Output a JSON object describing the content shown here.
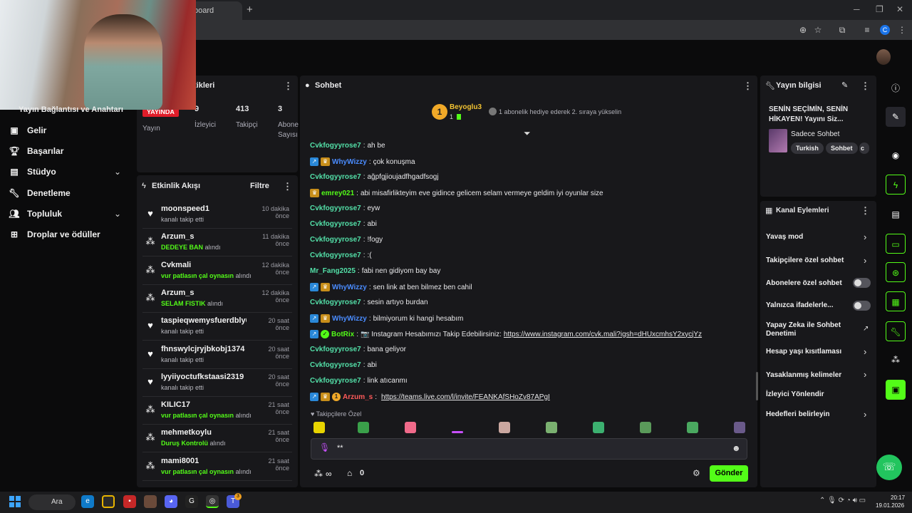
{
  "browser": {
    "tab_title": "board",
    "new_tab": "+",
    "profile_initial": "C"
  },
  "nav": {
    "partial_item": "Yayın Bağlantısı ve Anahtarı",
    "items": [
      {
        "label": "Gelir",
        "icon": "dollar-icon"
      },
      {
        "label": "Başarılar",
        "icon": "trophy-icon"
      },
      {
        "label": "Stüdyo",
        "icon": "studio-icon"
      },
      {
        "label": "Denetleme",
        "icon": "wrench-icon"
      },
      {
        "label": "Topluluk",
        "icon": "people-icon"
      },
      {
        "label": "Droplar ve ödüller",
        "icon": "gift-icon"
      }
    ]
  },
  "stats": {
    "title": "tikleri",
    "live": "YAYINDA",
    "live_label": "Yayın",
    "viewers_value": "9",
    "viewers_label": "İzleyici",
    "followers_value": "413",
    "followers_label": "Takipçi",
    "subs_value": "3",
    "subs_label_1": "Abone",
    "subs_label_2": "Sayısı"
  },
  "activity": {
    "title": "Etkinlik Akışı",
    "filter": "Filtre",
    "events": [
      {
        "name": "moonspeed1",
        "time": "10 dakika önce",
        "highlight": "",
        "sub": "kanalı takip etti",
        "type": "follow"
      },
      {
        "name": "Arzum_s",
        "time": "11 dakika önce",
        "highlight": "DEDEYE BAN",
        "sub": "alındı",
        "type": "reward"
      },
      {
        "name": "Cvkmali",
        "time": "12 dakika önce",
        "highlight": "vur patlasın çal oynasın",
        "sub": "alındı",
        "type": "reward"
      },
      {
        "name": "Arzum_s",
        "time": "12 dakika önce",
        "highlight": "SELAM FISTIK",
        "sub": "alındı",
        "type": "reward"
      },
      {
        "name": "taspieqwemysfuerdbly6743",
        "time": "20 saat önce",
        "highlight": "",
        "sub": "kanalı takip etti",
        "type": "follow"
      },
      {
        "name": "fhnswylcjryjbkobj1374",
        "time": "20 saat önce",
        "highlight": "",
        "sub": "kanalı takip etti",
        "type": "follow"
      },
      {
        "name": "lyyiiyoctufkstaasi2319",
        "time": "20 saat önce",
        "highlight": "",
        "sub": "kanalı takip etti",
        "type": "follow"
      },
      {
        "name": "KILIC17",
        "time": "21 saat önce",
        "highlight": "vur patlasın çal oynasın",
        "sub": "alındı",
        "type": "reward"
      },
      {
        "name": "mehmetkoylu",
        "time": "21 saat önce",
        "highlight": "Duruş Kontrolü",
        "sub": "alındı",
        "type": "reward"
      },
      {
        "name": "mami8001",
        "time": "21 saat önce",
        "highlight": "vur patlasın çal oynasın",
        "sub": "alındı",
        "type": "reward"
      }
    ]
  },
  "chat": {
    "title": "Sohbet",
    "top_gifter_rank": "1",
    "top_gifter_name": "Beyoglu3",
    "top_gifter_count": "1",
    "gift_message": "1 abonelik hediye ederek 2. sıraya yükselin",
    "messages": [
      {
        "user": "Cvkfogyyrose7",
        "color": "#53e0a8",
        "badges": [],
        "text": "ah be",
        "link": ""
      },
      {
        "user": "WhyWizzy",
        "color": "#4a8cff",
        "badges": [
          "mod",
          "crown"
        ],
        "text": "çok konuşma",
        "link": ""
      },
      {
        "user": "Cvkfogyyrose7",
        "color": "#53e0a8",
        "badges": [],
        "text": "ağpfgjioujadfhgadfsogj",
        "link": ""
      },
      {
        "user": "emrey021",
        "color": "#53fc18",
        "badges": [
          "crown"
        ],
        "text": "abi misafirlikteyim eve gidince gelicem selam vermeye geldim iyi oyunlar size",
        "link": ""
      },
      {
        "user": "Cvkfogyyrose7",
        "color": "#53e0a8",
        "badges": [],
        "text": "eyw",
        "link": ""
      },
      {
        "user": "Cvkfogyyrose7",
        "color": "#53e0a8",
        "badges": [],
        "text": "abi",
        "link": ""
      },
      {
        "user": "Cvkfogyyrose7",
        "color": "#53e0a8",
        "badges": [],
        "text": "!fogy",
        "link": ""
      },
      {
        "user": "Cvkfogyyrose7",
        "color": "#53e0a8",
        "badges": [],
        "text": ":(",
        "link": ""
      },
      {
        "user": "Mr_Fang2025",
        "color": "#53e0a8",
        "badges": [],
        "text": "fabi nen gidiyom bay bay",
        "link": ""
      },
      {
        "user": "WhyWizzy",
        "color": "#4a8cff",
        "badges": [
          "mod",
          "crown"
        ],
        "text": "sen link at ben bilmez ben cahil",
        "link": ""
      },
      {
        "user": "Cvkfogyyrose7",
        "color": "#53e0a8",
        "badges": [],
        "text": "sesin artıyo burdan",
        "link": ""
      },
      {
        "user": "WhyWizzy",
        "color": "#4a8cff",
        "badges": [
          "mod",
          "crown"
        ],
        "text": "bilmiyorum ki hangi hesabım",
        "link": ""
      },
      {
        "user": "BotRix",
        "color": "#53fc18",
        "badges": [
          "mod",
          "verified"
        ],
        "text": "📷 Instagram Hesabımızı Takip Edebilirsiniz:",
        "link": "https://www.instagram.com/cvk.mali?igsh=dHUxcmhsY2xycjYz"
      },
      {
        "user": "Cvkfogyyrose7",
        "color": "#53e0a8",
        "badges": [],
        "text": "bana geliyor",
        "link": ""
      },
      {
        "user": "Cvkfogyyrose7",
        "color": "#53e0a8",
        "badges": [],
        "text": "abi",
        "link": ""
      },
      {
        "user": "Cvkfogyyrose7",
        "color": "#53e0a8",
        "badges": [],
        "text": "link atıcanmı",
        "link": ""
      },
      {
        "user": "Arzum_s",
        "color": "#ff5a5a",
        "badges": [
          "mod",
          "crown",
          "sub"
        ],
        "text": "",
        "link": "https://teams.live.com/l/invite/FEANKAfSHoZv87APgI"
      }
    ],
    "followers_only": "♥ Takipçilere Özel",
    "input_value": "**",
    "points_value": "∞",
    "store_value": "0",
    "send": "Gönder"
  },
  "stream_info": {
    "title": "Yayın bilgisi",
    "stream_title": "SENİN SEÇİMİN, SENİN HİKAYEN! Yayını Siz...",
    "category": "Sadece Sohbet",
    "tags": [
      "Turkish",
      "Sohbet",
      "c"
    ]
  },
  "channel_actions": {
    "title": "Kanal Eylemleri",
    "items": [
      {
        "label": "Yavaş mod",
        "kind": "chevron"
      },
      {
        "label": "Takipçilere özel sohbet",
        "kind": "chevron"
      },
      {
        "label": "Abonelere özel sohbet",
        "kind": "toggle"
      },
      {
        "label": "Yalnızca ifadelerle...",
        "kind": "toggle"
      },
      {
        "label": "Yapay Zeka ile Sohbet Denetimi",
        "kind": "external"
      },
      {
        "label": "Hesap yaşı kısıtlaması",
        "kind": "chevron"
      },
      {
        "label": "Yasaklanmış kelimeler",
        "kind": "chevron"
      },
      {
        "label": "İzleyici Yönlendir",
        "kind": "none"
      },
      {
        "label": "Hedefleri belirleyin",
        "kind": "chevron"
      }
    ]
  },
  "taskbar": {
    "search": "Ara",
    "time": "20:17",
    "date": "19.01.2026",
    "badge": "3"
  },
  "colors": {
    "accent": "#53fc18",
    "panel": "#18181b",
    "live": "#e01d2a"
  }
}
